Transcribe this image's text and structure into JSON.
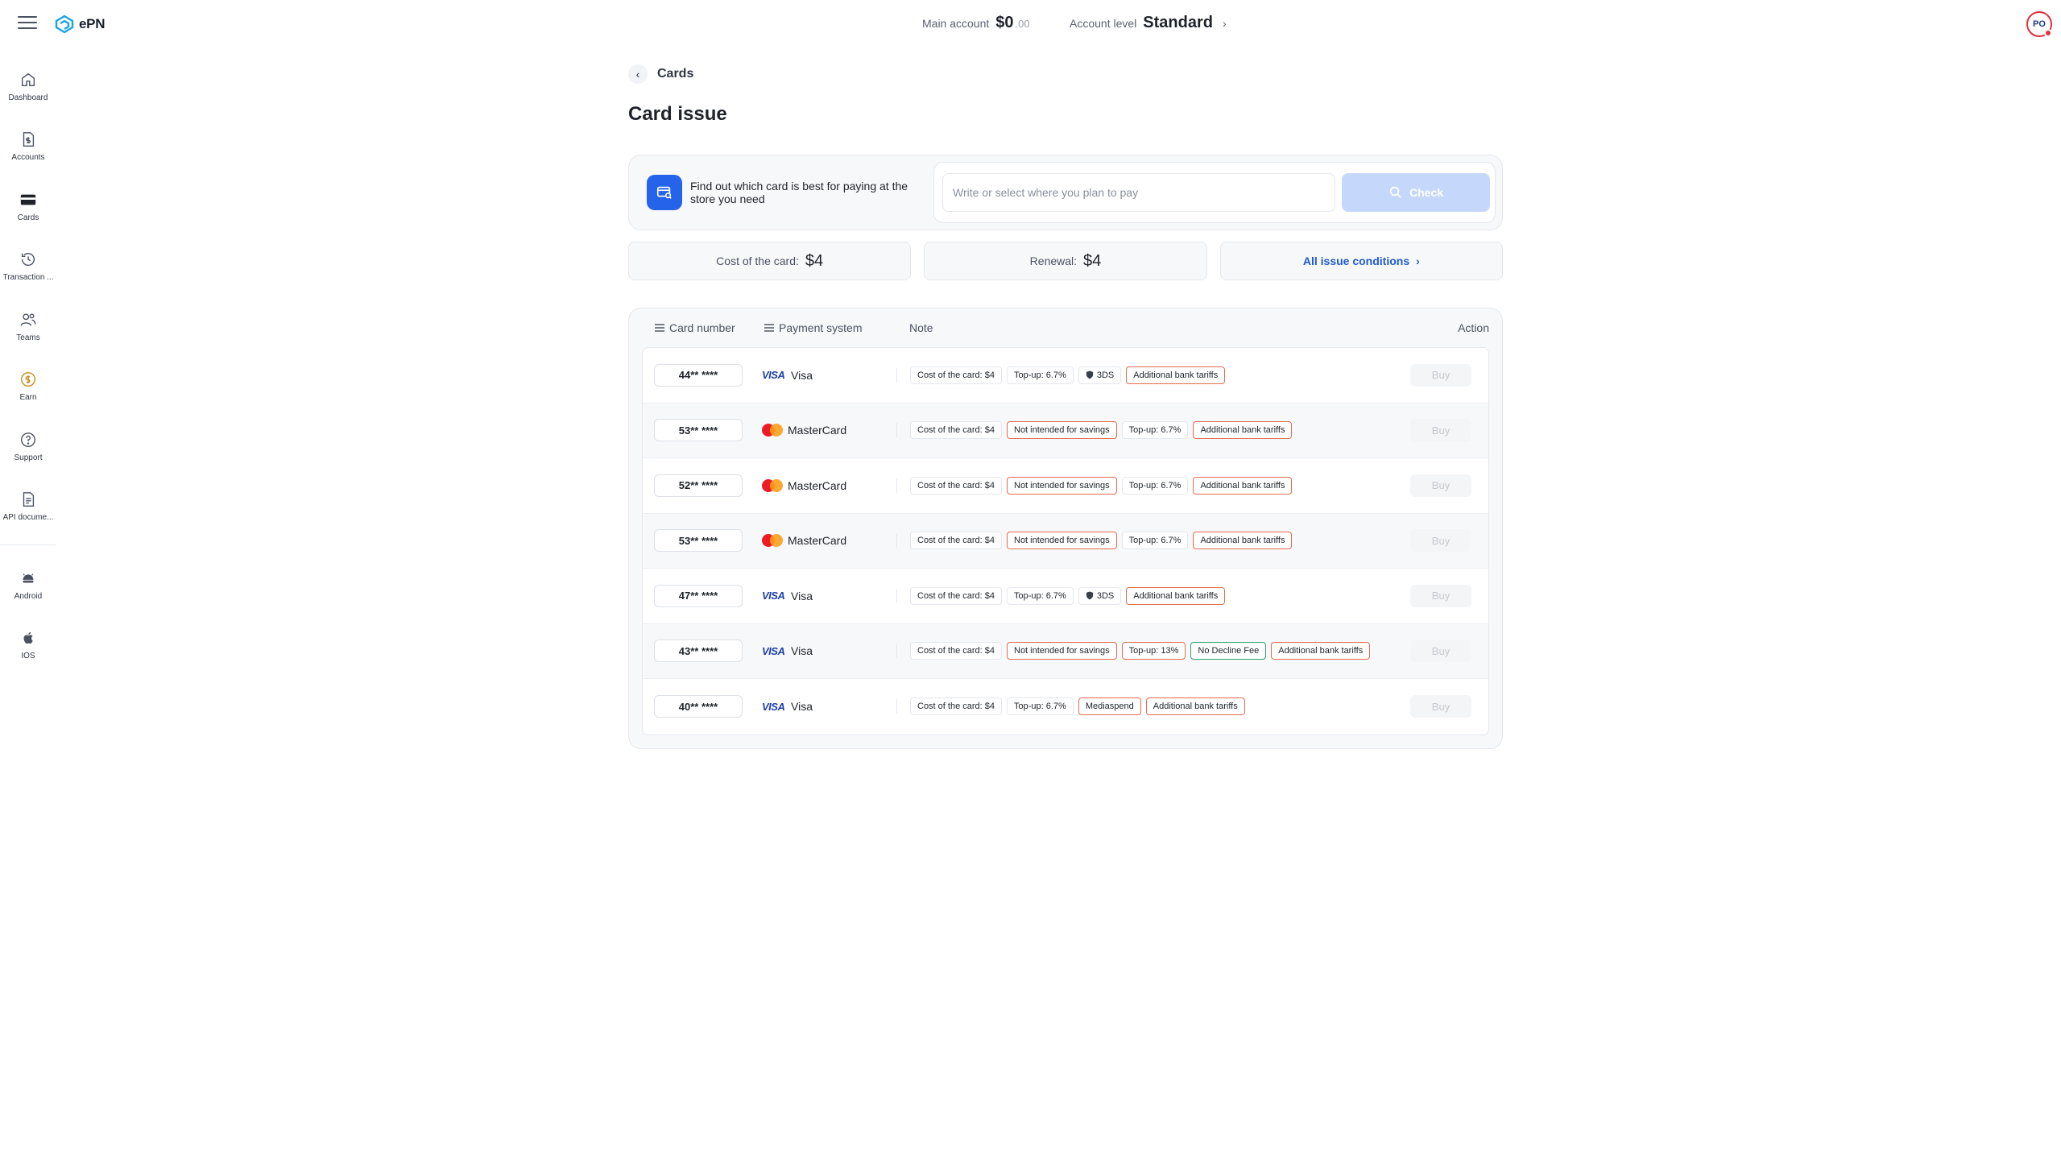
{
  "app": {
    "logo_text": "ePN"
  },
  "header": {
    "main_account_label": "Main account",
    "main_account_value": "$0",
    "main_account_cents": ".00",
    "level_label": "Account level",
    "level_value": "Standard",
    "avatar_initials": "PO"
  },
  "sidebar": {
    "items": [
      {
        "label": "Dashboard",
        "icon": "home-icon"
      },
      {
        "label": "Accounts",
        "icon": "dollar-doc-icon"
      },
      {
        "label": "Cards",
        "icon": "card-icon",
        "active": true
      },
      {
        "label": "Transaction ...",
        "icon": "history-icon"
      },
      {
        "label": "Teams",
        "icon": "users-icon"
      },
      {
        "label": "Earn",
        "icon": "coin-icon"
      },
      {
        "label": "Support",
        "icon": "help-icon"
      },
      {
        "label": "API docume...",
        "icon": "document-icon"
      }
    ],
    "apps": [
      {
        "label": "Android",
        "icon": "android-icon"
      },
      {
        "label": "IOS",
        "icon": "apple-icon"
      }
    ]
  },
  "page": {
    "breadcrumb": "Cards",
    "title": "Card issue"
  },
  "finder": {
    "text": "Find out which card is best for paying at the store you need",
    "placeholder": "Write or select where you plan to pay",
    "check_label": "Check"
  },
  "stats": {
    "cost_label": "Cost of the card:",
    "cost_value": "$4",
    "renewal_label": "Renewal:",
    "renewal_value": "$4",
    "conditions_link": "All issue conditions"
  },
  "table": {
    "headers": {
      "number": "Card number",
      "payment": "Payment system",
      "note": "Note",
      "action": "Action"
    },
    "buy_label": "Buy",
    "rows": [
      {
        "number": "44** ****",
        "system": "Visa",
        "tags": [
          {
            "t": "Cost of the card: $4",
            "k": ""
          },
          {
            "t": "Top-up: 6.7%",
            "k": ""
          },
          {
            "t": "3DS",
            "k": "shield"
          },
          {
            "t": "Additional bank tariffs",
            "k": "warn"
          }
        ]
      },
      {
        "number": "53** ****",
        "system": "MasterCard",
        "tags": [
          {
            "t": "Cost of the card: $4",
            "k": ""
          },
          {
            "t": "Not intended for savings",
            "k": "warn"
          },
          {
            "t": "Top-up: 6.7%",
            "k": ""
          },
          {
            "t": "Additional bank tariffs",
            "k": "warn"
          }
        ]
      },
      {
        "number": "52** ****",
        "system": "MasterCard",
        "tags": [
          {
            "t": "Cost of the card: $4",
            "k": ""
          },
          {
            "t": "Not intended for savings",
            "k": "warn"
          },
          {
            "t": "Top-up: 6.7%",
            "k": ""
          },
          {
            "t": "Additional bank tariffs",
            "k": "warn"
          }
        ]
      },
      {
        "number": "53** ****",
        "system": "MasterCard",
        "tags": [
          {
            "t": "Cost of the card: $4",
            "k": ""
          },
          {
            "t": "Not intended for savings",
            "k": "warn"
          },
          {
            "t": "Top-up: 6.7%",
            "k": ""
          },
          {
            "t": "Additional bank tariffs",
            "k": "warn"
          }
        ]
      },
      {
        "number": "47** ****",
        "system": "Visa",
        "tags": [
          {
            "t": "Cost of the card: $4",
            "k": ""
          },
          {
            "t": "Top-up: 6.7%",
            "k": ""
          },
          {
            "t": "3DS",
            "k": "shield"
          },
          {
            "t": "Additional bank tariffs",
            "k": "warn"
          }
        ]
      },
      {
        "number": "43** ****",
        "system": "Visa",
        "tags": [
          {
            "t": "Cost of the card: $4",
            "k": ""
          },
          {
            "t": "Not intended for savings",
            "k": "warn"
          },
          {
            "t": "Top-up: 13%",
            "k": "warn"
          },
          {
            "t": "No Decline Fee",
            "k": "ok"
          },
          {
            "t": "Additional bank tariffs",
            "k": "warn"
          }
        ]
      },
      {
        "number": "40** ****",
        "system": "Visa",
        "tags": [
          {
            "t": "Cost of the card: $4",
            "k": ""
          },
          {
            "t": "Top-up: 6.7%",
            "k": ""
          },
          {
            "t": "Mediaspend",
            "k": "warn"
          },
          {
            "t": "Additional bank tariffs",
            "k": "warn"
          }
        ]
      }
    ]
  },
  "colors": {
    "accent": "#2563eb",
    "warn_border": "#e26a4f",
    "ok_border": "#2f9e6a",
    "link": "#1f5ad1"
  }
}
